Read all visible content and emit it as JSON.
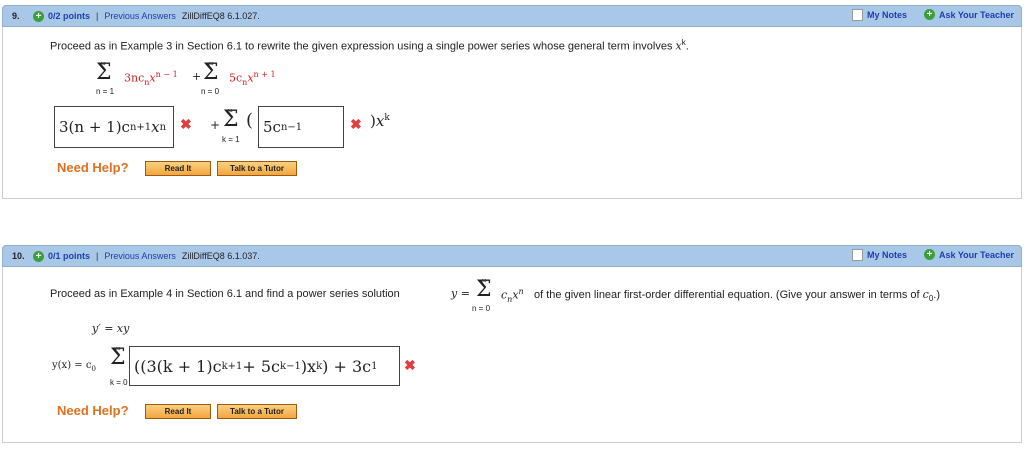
{
  "q9": {
    "number": "9.",
    "plus": "+",
    "points": "0/2 points",
    "separator": "|",
    "previous": "Previous Answers",
    "code": "ZillDiffEQ8 6.1.027.",
    "my_notes": "My Notes",
    "ask_teacher": "Ask Your Teacher",
    "prompt": "Proceed as in Example 3 in Section 6.1 to rewrite the given expression using a single power series whose general term involves",
    "prompt_var": "x",
    "prompt_sup": "k",
    "prompt_end": ".",
    "expr": {
      "sum_symbol": "Σ",
      "inf": "∞",
      "term1": "3nc",
      "term1_sub": "n",
      "term1_x": "x",
      "term1_exp": "n − 1",
      "lower1": "n = 1",
      "plus": "+",
      "term2": "5c",
      "term2_sub": "n",
      "term2_x": "x",
      "term2_exp": "n + 1",
      "lower2": "n = 0"
    },
    "answer1": "3(n + 1)c",
    "answer1_sub": "n+1",
    "answer1_x": "x",
    "answer1_exp": "n",
    "mid_plus": "+",
    "sum_lower": "k = 1",
    "paren_open": "(",
    "answer2": "5c",
    "answer2_sub": "n−1",
    "paren_close": ")",
    "xk": "x",
    "xk_exp": "k",
    "wrong_mark": "✖",
    "need_help": "Need Help?",
    "read_it": "Read It",
    "talk_tutor": "Talk to a Tutor"
  },
  "q10": {
    "number": "10.",
    "plus": "+",
    "points": "0/1 points",
    "separator": "|",
    "previous": "Previous Answers",
    "code": "ZillDiffEQ8 6.1.037.",
    "my_notes": "My Notes",
    "ask_teacher": "Ask Your Teacher",
    "prompt_a": "Proceed as in Example 4 in Section 6.1 and find a power series solution",
    "y_eq": "y =",
    "series": "c",
    "series_sub": "n",
    "series_x": "x",
    "series_exp": "n",
    "series_lower": "n = 0",
    "prompt_b": "of the given linear first-order differential equation. (Give your answer in terms of",
    "c0": "c",
    "c0_sub": "0",
    "prompt_c": ".)",
    "ode": "y′ = xy",
    "yx": "y(x) = c",
    "yx_sub": "0",
    "sum_lower": "k = 0",
    "answer": "((3(k + 1)c",
    "answer_sub1": "k+1",
    "answer_mid": " + 5c",
    "answer_sub2": "k−1",
    "answer_tail": ")x",
    "answer_exp": "k",
    "answer_end": ") + 3c",
    "answer_sub3": "1",
    "wrong_mark": "✖",
    "need_help": "Need Help?",
    "read_it": "Read It",
    "talk_tutor": "Talk to a Tutor"
  }
}
